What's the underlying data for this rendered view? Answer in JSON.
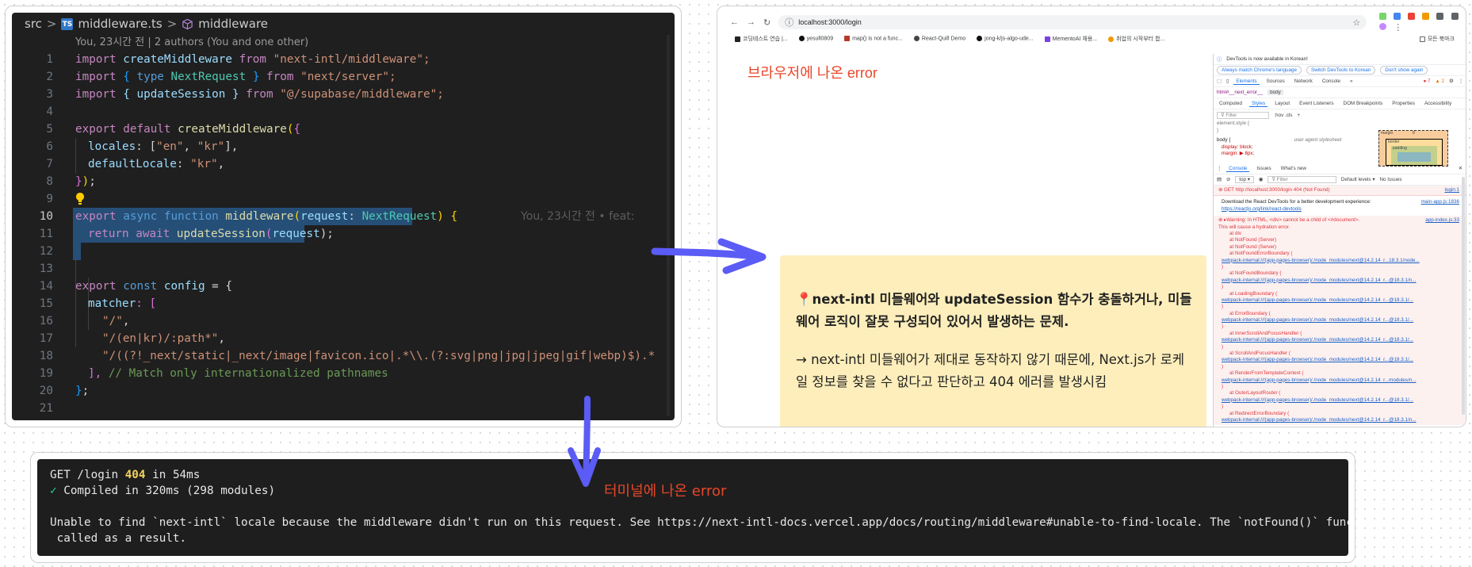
{
  "editor": {
    "breadcrumb": {
      "folder": "src",
      "file": "middleware.ts",
      "symbol": "middleware",
      "ts_badge": "TS"
    },
    "blame_header": "You, 23시간 전 | 2 authors (You and one other)",
    "inline_blame": "You, 23시간 전 • feat:",
    "active_line": 10,
    "line_numbers": [
      "1",
      "2",
      "3",
      "4",
      "5",
      "6",
      "7",
      "8",
      "9",
      "10",
      "11",
      "12",
      "13",
      "14",
      "15",
      "16",
      "17",
      "18",
      "19",
      "20",
      "21"
    ],
    "code": {
      "l1": [
        "import",
        " createMiddleware ",
        "from",
        " \"next-intl/middleware\";"
      ],
      "l2": [
        "import",
        " { ",
        "type",
        " NextRequest",
        " } ",
        "from",
        " \"next/server\";"
      ],
      "l3": [
        "import",
        " { updateSession } ",
        "from",
        " \"@/supabase/middleware\";"
      ],
      "l5": [
        "export",
        " ",
        "default",
        " createMiddleware",
        "(",
        "{"
      ],
      "l6": [
        "locales",
        ": [",
        "\"en\"",
        ", ",
        "\"kr\"",
        "],"
      ],
      "l7": [
        "defaultLocale",
        ": ",
        "\"kr\"",
        ","
      ],
      "l8": [
        "}",
        ")",
        ";"
      ],
      "l10": [
        "export",
        " ",
        "async",
        " ",
        "function",
        " ",
        "middleware",
        "(",
        "request",
        ": ",
        "NextRequest",
        ") {"
      ],
      "l11": [
        "return",
        " ",
        "await",
        " ",
        "updateSession",
        "(",
        "request",
        ");"
      ],
      "l14": [
        "export",
        " ",
        "const",
        " ",
        "config",
        " = {"
      ],
      "l15": [
        "matcher",
        ": ["
      ],
      "l16": [
        "\"/\"",
        ","
      ],
      "l17": [
        "\"/(en|kr)/:path*\"",
        ","
      ],
      "l18": [
        "\"/((?!_next/static|_next/image|favicon.ico|.*\\\\.(?:svg|png|jpg|jpeg|gif|webp)$).*"
      ],
      "l19": [
        "], ",
        "// Match only internationalized pathnames"
      ],
      "l20": [
        "}",
        ";"
      ]
    }
  },
  "browser": {
    "url": "localhost:3000/login",
    "bookmarks": [
      "코딩테스트 연습 |...",
      "yesull0809",
      "map() is not a func...",
      "React-Quill Demo",
      "jong-k/js-algo-ude...",
      "MementoAI 채용...",
      "취업의 시작부터 합..."
    ],
    "bookmarks_folder": "모든 북마크",
    "page_note": "브라우저에 나온 error",
    "callout": {
      "pin": "📍",
      "bold": "next-intl 미들웨어와 updateSession 함수가 충돌하거나, 미들웨어 로직이 잘못 구성되어 있어서 발생하는 문제.",
      "body": "→ next-intl 미들웨어가 제대로 동작하지 않기 때문에, Next.js가 로케일 정보를 찾을 수 없다고 판단하고 404 에러를 발생시킴"
    },
    "devtools": {
      "notice": "DevTools is now available in Korean!",
      "btn_always": "Always match Chrome's language",
      "btn_switch": "Switch DevTools to Korean",
      "btn_dont": "Don't show again",
      "tabs": [
        "Elements",
        "Sources",
        "Network",
        "Console",
        "»"
      ],
      "errors": "7",
      "warnings": "2",
      "dom_crumbs": [
        "html#__next_error__",
        "body"
      ],
      "style_tabs": [
        "Computed",
        "Styles",
        "Layout",
        "Event Listeners",
        "DOM Breakpoints",
        "Properties",
        "Accessibility"
      ],
      "filter": "Filter",
      "hov": ":hov  .cls",
      "element_style": "element.style {",
      "body_rule": "body {",
      "ua": "user agent stylesheet",
      "display": "display: block;",
      "margin": "margin: ▶ 8px;",
      "box_labels": {
        "margin": "margin",
        "border": "border",
        "padding": "padding",
        "margin_val": "8"
      },
      "drawer_tabs": [
        "Console",
        "Issues",
        "What's new"
      ],
      "ctx": "top ▾",
      "levels": "Default levels ▾",
      "issues": "No Issues",
      "get_line": "GET http://localhost:3000/login 404 (Not Found)",
      "get_src": "login:1",
      "react_line_1": "Download the React DevTools for a better development experience:",
      "react_line_2": "https://reactjs.org/link/react-devtools",
      "react_src": "main-app.js:1836",
      "warning_head": "Warning: In HTML, <div> cannot be a child of <#document>.",
      "warning_src": "app-index.js:33",
      "warning_sub": "This will cause a hydration error.",
      "stack": [
        "at div",
        "at NotFound (Server)",
        "at NotFound (Server)",
        "at NotFoundErrorBoundary (",
        "webpack-internal:///(app-pages-browser)/./node_modules/next@14.2.14_r...18.3.1/node...",
        ")",
        "at NotFoundBoundary (",
        "webpack-internal:///(app-pages-browser)/./node_modules/next@14.2.14_r...@18.3.1/n...",
        ")",
        "at LoadingBoundary (",
        "webpack-internal:///(app-pages-browser)/./node_modules/next@14.2.14_r...@18.3.1/...",
        ")",
        "at ErrorBoundary (",
        "webpack-internal:///(app-pages-browser)/./node_modules/next@14.2.14_r...@18.3.1/...",
        ")",
        "at InnerScrollAndFocusHandler (",
        "webpack-internal:///(app-pages-browser)/./node_modules/next@14.2.14_r...@18.3.1/...",
        ")",
        "at ScrollAndFocusHandler (",
        "webpack-internal:///(app-pages-browser)/./node_modules/next@14.2.14_r...@18.3.1/...",
        ")",
        "at RenderFromTemplateContext (",
        "webpack-internal:///(app-pages-browser)/./node_modules/next@14.2.14_r...modules/n...",
        ")",
        "at OuterLayoutRouter (",
        "webpack-internal:///(app-pages-browser)/./node_modules/next@14.2.14_r...@18.3.1/...",
        ")",
        "at RedirectErrorBoundary (",
        "webpack-internal:///(app-pages-browser)/./node_modules/next@14.2.14_r...@18.3.1/n..."
      ]
    }
  },
  "terminal": {
    "line1_pre": "GET /login ",
    "line1_status": "404",
    "line1_post": " in 54ms",
    "line2_check": "✓",
    "line2": " Compiled in 320ms (298 modules)",
    "line3": "Unable to find `next-intl` locale because the middleware didn't run on this request. See https://next-intl-docs.vercel.app/docs/routing/middleware#unable-to-find-locale. The `notFound()` function will be",
    "line4": " called as a result.",
    "note": "터미널에 나온 error"
  },
  "colors": {
    "arrow": "#5b5bf5",
    "note_red": "#e8472a",
    "callout_bg": "#fdeebb"
  }
}
